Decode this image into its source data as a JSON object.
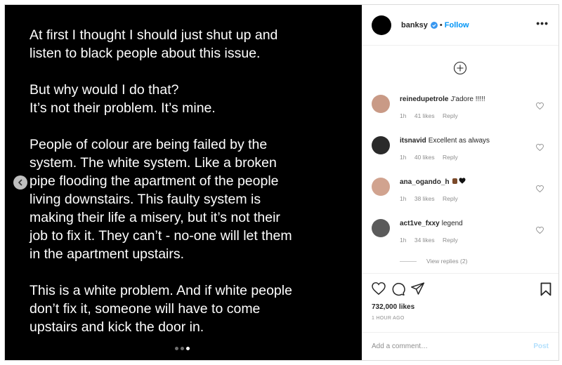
{
  "media": {
    "paragraphs": [
      [
        "At first I thought I should just shut up and",
        "listen to black people about this issue."
      ],
      [
        "But why would I do that?",
        "It’s not their problem. It’s mine."
      ],
      [
        "People of colour are being failed by the",
        "system. The white system. Like a broken",
        "pipe flooding the apartment of the people",
        "living downstairs. This faulty system is",
        "making their life a misery, but it’s not their",
        "job to fix it. They can’t - no-one will let them",
        "in the apartment upstairs."
      ],
      [
        "This is a white problem. And if white people",
        "don’t fix it, someone will have to come",
        "upstairs and kick the door in."
      ]
    ],
    "carousel_dots": 3,
    "active_dot": 2
  },
  "header": {
    "username": "banksy",
    "separator": "•",
    "follow_label": "Follow",
    "more_label": "•••"
  },
  "comments": [
    {
      "user": "reinedupetrole",
      "text": "J'adore !!!!!",
      "time": "1h",
      "likes": "41 likes",
      "reply": "Reply",
      "avatar_color": "#c99a86"
    },
    {
      "user": "itsnavid",
      "text": "Excellent as always",
      "time": "1h",
      "likes": "40 likes",
      "reply": "Reply",
      "avatar_color": "#2a2a2a"
    },
    {
      "user": "ana_ogando_h",
      "text": "",
      "time": "1h",
      "likes": "38 likes",
      "reply": "Reply",
      "avatar_color": "#d1a38f"
    },
    {
      "user": "act1ve_fxxy",
      "text": "legend",
      "time": "1h",
      "likes": "34 likes",
      "reply": "Reply",
      "avatar_color": "#5b5b5b"
    }
  ],
  "view_replies": "View replies (2)",
  "actions": {
    "likes": "732,000 likes",
    "time": "1 HOUR AGO"
  },
  "add_comment": {
    "placeholder": "Add a comment…",
    "post_label": "Post"
  },
  "colors": {
    "accent": "#0095f6",
    "post_disabled": "#b2dffc",
    "muted": "#8e8e8e"
  }
}
